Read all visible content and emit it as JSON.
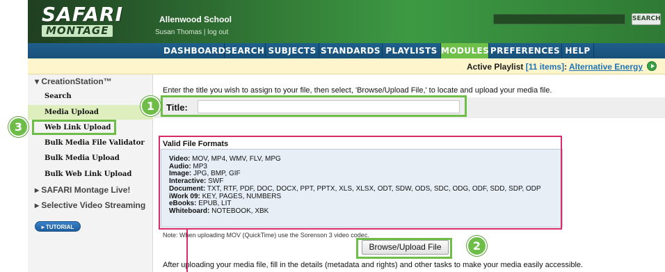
{
  "header": {
    "logo_top": "SAFARI",
    "logo_bottom": "MONTAGE",
    "school_name": "Allenwood School",
    "user_line": "Susan Thomas  |  log out",
    "search_button": "SEARCH"
  },
  "nav": {
    "items": [
      "DASHBOARD",
      "SEARCH",
      "SUBJECTS",
      "STANDARDS",
      "PLAYLISTS",
      "MODULES",
      "PREFERENCES",
      "HELP"
    ],
    "active": "MODULES"
  },
  "playlist": {
    "label": "Active Playlist",
    "count": "[11 items]",
    "colon": ":",
    "name": "Alternative Energy"
  },
  "sidebar": {
    "creation_station": "▾ CreationStation™",
    "items": [
      "Search",
      "Media Upload",
      "Web Link Upload",
      "Bulk Media File Validator",
      "Bulk Media Upload",
      "Bulk Web Link Upload"
    ],
    "safari_live": "▸ SAFARI Montage Live!",
    "selective_video": "▸ Selective Video Streaming",
    "tutorial": "▸ TUTORIAL"
  },
  "main": {
    "intro": "Enter the title you wish to assign to your file, then select, 'Browse/Upload File,' to locate and upload your media file.",
    "title_label": "Title:",
    "title_value": "",
    "formats_heading": "Valid File Formats",
    "formats": [
      {
        "label": "Video:",
        "value": " MOV, MP4, WMV, FLV, MPG"
      },
      {
        "label": "Audio:",
        "value": " MP3"
      },
      {
        "label": "Image:",
        "value": " JPG, BMP, GIF"
      },
      {
        "label": "Interactive:",
        "value": " SWF"
      },
      {
        "label": "Document:",
        "value": " TXT, RTF, PDF, DOC, DOCX, PPT, PPTX, XLS, XLSX, ODT, SDW, ODS, SDC, ODG, ODF, SDD, SDP, ODP"
      },
      {
        "label": "iWork 09:",
        "value": " KEY, PAGES, NUMBERS"
      },
      {
        "label": "eBooks:",
        "value": " EPUB, LIT"
      },
      {
        "label": "Whiteboard:",
        "value": " NOTEBOOK, XBK"
      }
    ],
    "note": "Note: When uploading MOV (QuickTime) use the Sorenson 3 video codec.",
    "upload_button": "Browse/Upload File",
    "after": "After uploading your media file, fill in the details (metadata and rights) and other tasks to make your media easily accessible."
  },
  "callouts": [
    "1",
    "2",
    "3"
  ],
  "colors": {
    "nav_bg": "#1f5f8c",
    "active_tab": "#6fbf4b",
    "callout_green": "#6dbd48",
    "callout_pink": "#d92b6b",
    "link": "#1d73b3"
  }
}
